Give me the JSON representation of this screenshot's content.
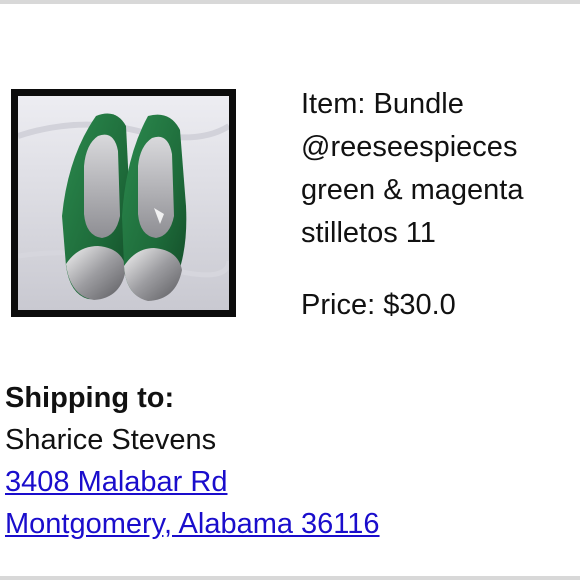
{
  "item": {
    "label": "Item:",
    "name_lines": [
      "Bundle",
      "@reeseespieces",
      "green & magenta",
      "stilletos 11"
    ]
  },
  "price": {
    "label": "Price:",
    "value": "$30.0"
  },
  "shipping": {
    "heading": "Shipping to:",
    "recipient": "Sharice Stevens",
    "address_line1": "3408 Malabar Rd",
    "address_line2": "Montgomery, Alabama 36116"
  },
  "colors": {
    "link": "#1a0dcc",
    "shoe_green": "#1e6b3a",
    "thumb_border": "#0c0c0c"
  },
  "image": {
    "subject": "green suede stiletto pumps with metallic silver toe caps"
  }
}
